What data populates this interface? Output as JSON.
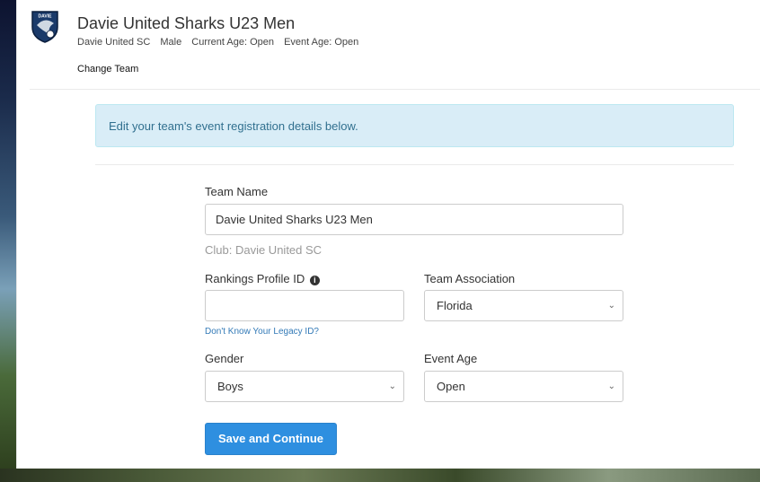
{
  "team": {
    "name": "Davie United Sharks U23 Men",
    "club": "Davie United SC",
    "gender": "Male",
    "current_age": "Current Age: Open",
    "event_age": "Event Age: Open",
    "change_team_label": "Change Team",
    "logo_text": "DAVIE"
  },
  "alert": {
    "message": "Edit your team's event registration details below."
  },
  "form": {
    "team_name_label": "Team Name",
    "team_name_value": "Davie United Sharks U23 Men",
    "club_text": "Club: Davie United SC",
    "rankings_label": "Rankings Profile ID",
    "rankings_value": "",
    "legacy_link": "Don't Know Your Legacy ID?",
    "association_label": "Team Association",
    "association_value": "Florida",
    "gender_label": "Gender",
    "gender_value": "Boys",
    "event_age_label": "Event Age",
    "event_age_value": "Open",
    "submit_label": "Save and Continue"
  },
  "colors": {
    "primary": "#2e8fe0",
    "alert_bg": "#d9edf7",
    "alert_text": "#31708f",
    "link": "#337ab7"
  }
}
